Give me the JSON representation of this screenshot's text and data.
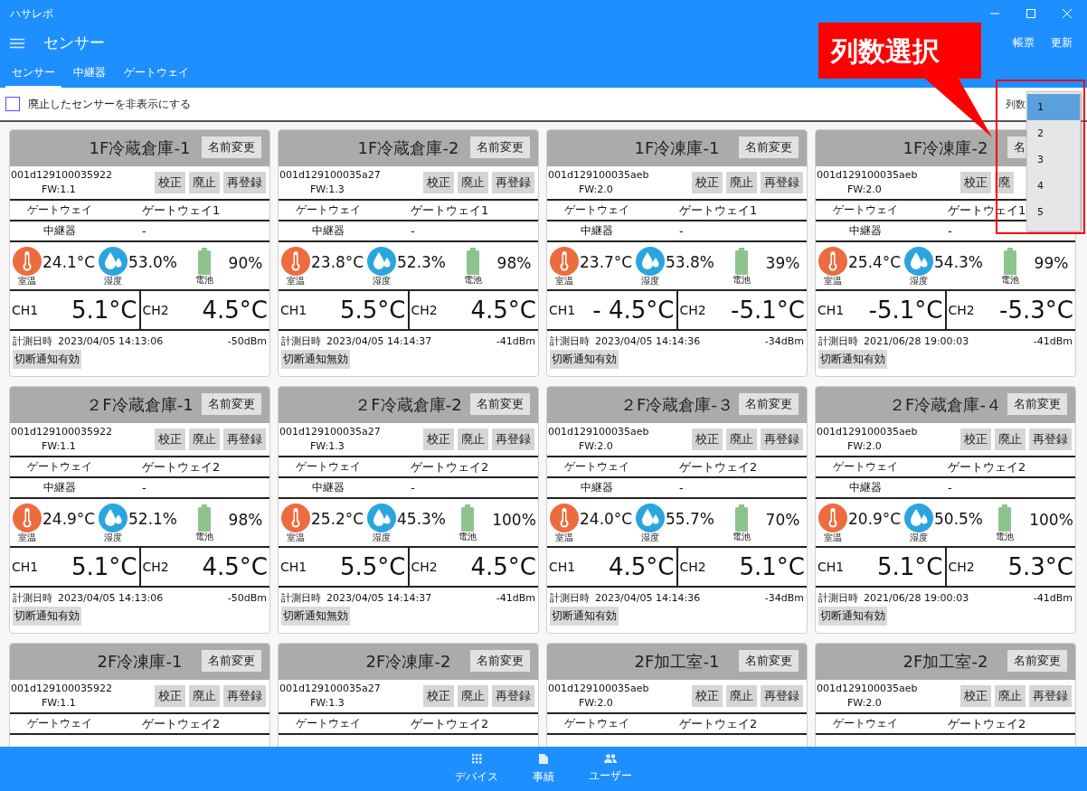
{
  "window": {
    "title": "ハサレポ"
  },
  "header": {
    "title": "センサー",
    "actions": [
      "帳票",
      "更新"
    ]
  },
  "tabs": [
    {
      "label": "センサー",
      "selected": true
    },
    {
      "label": "中継器",
      "selected": false
    },
    {
      "label": "ゲートウェイ",
      "selected": false
    }
  ],
  "filter": {
    "label": "廃止したセンサーを非表示にする",
    "checked": false
  },
  "columns": {
    "label": "列数",
    "options": [
      {
        "label": "1",
        "selected": true
      },
      {
        "label": "2",
        "selected": false
      },
      {
        "label": "3",
        "selected": false
      },
      {
        "label": "4",
        "selected": false
      },
      {
        "label": "5",
        "selected": false
      }
    ]
  },
  "callout": {
    "text": "列数選択"
  },
  "cards": [
    {
      "name": "1F冷蔵倉庫-1",
      "rename": "名前変更",
      "id": "001d129100035922",
      "fw": "FW:1.1",
      "actions": [
        "校正",
        "廃止",
        "再登録"
      ],
      "rows": [
        {
          "label": "ゲートウェイ",
          "value": "ゲートウェイ1"
        },
        {
          "label": "中継器",
          "value": "-"
        }
      ],
      "readings": [
        {
          "kind": "temperature",
          "caption": "室温",
          "value": "24.1°C"
        },
        {
          "kind": "humidity",
          "caption": "湿度",
          "value": "53.0%"
        },
        {
          "kind": "battery",
          "caption": "電池",
          "value": "90%"
        }
      ],
      "channels": [
        {
          "label": "CH1",
          "value": "5.1°C"
        },
        {
          "label": "CH2",
          "value": "4.5°C"
        }
      ],
      "measured_label": "計測日時",
      "measured": "2023/04/05 14:13:06",
      "signal": "-50dBm",
      "notify": "切断通知有効"
    },
    {
      "name": "1F冷蔵倉庫-2",
      "rename": "名前変更",
      "id": "001d129100035a27",
      "fw": "FW:1.3",
      "actions": [
        "校正",
        "廃止",
        "再登録"
      ],
      "rows": [
        {
          "label": "ゲートウェイ",
          "value": "ゲートウェイ1"
        },
        {
          "label": "中継器",
          "value": "-"
        }
      ],
      "readings": [
        {
          "kind": "temperature",
          "caption": "室温",
          "value": "23.8°C"
        },
        {
          "kind": "humidity",
          "caption": "湿度",
          "value": "52.3%"
        },
        {
          "kind": "battery",
          "caption": "電池",
          "value": "98%"
        }
      ],
      "channels": [
        {
          "label": "CH1",
          "value": "5.5°C"
        },
        {
          "label": "CH2",
          "value": "4.5°C"
        }
      ],
      "measured_label": "計測日時",
      "measured": "2023/04/05 14:14:37",
      "signal": "-41dBm",
      "notify": "切断通知無効"
    },
    {
      "name": "1F冷凍庫-1",
      "rename": "名前変更",
      "id": "001d129100035aeb",
      "fw": "FW:2.0",
      "actions": [
        "校正",
        "廃止",
        "再登録"
      ],
      "rows": [
        {
          "label": "ゲートウェイ",
          "value": "ゲートウェイ1"
        },
        {
          "label": "中継器",
          "value": "-"
        }
      ],
      "readings": [
        {
          "kind": "temperature",
          "caption": "室温",
          "value": "23.7°C"
        },
        {
          "kind": "humidity",
          "caption": "湿度",
          "value": "53.8%"
        },
        {
          "kind": "battery",
          "caption": "電池",
          "value": "39%"
        }
      ],
      "channels": [
        {
          "label": "CH1",
          "value": "- 4.5°C"
        },
        {
          "label": "CH2",
          "value": "-5.1°C"
        }
      ],
      "measured_label": "計測日時",
      "measured": "2023/04/05 14:14:36",
      "signal": "-34dBm",
      "notify": "切断通知有効"
    },
    {
      "name": "1F冷凍庫-2",
      "rename": "名",
      "id": "001d129100035aeb",
      "fw": "FW:2.0",
      "actions": [
        "校正",
        "廃"
      ],
      "rows": [
        {
          "label": "ゲートウェイ",
          "value": "ゲートウェイ1"
        },
        {
          "label": "中継器",
          "value": "-"
        }
      ],
      "readings": [
        {
          "kind": "temperature",
          "caption": "室温",
          "value": "25.4°C"
        },
        {
          "kind": "humidity",
          "caption": "湿度",
          "value": "54.3%"
        },
        {
          "kind": "battery",
          "caption": "電池",
          "value": "99%"
        }
      ],
      "channels": [
        {
          "label": "CH1",
          "value": "-5.1°C"
        },
        {
          "label": "CH2",
          "value": "-5.3°C"
        }
      ],
      "measured_label": "計測日時",
      "measured": "2021/06/28 19:00:03",
      "signal": "-41dBm",
      "notify": "切断通知有効"
    },
    {
      "name": "２F冷蔵倉庫-1",
      "rename": "名前変更",
      "id": "001d129100035922",
      "fw": "FW:1.1",
      "actions": [
        "校正",
        "廃止",
        "再登録"
      ],
      "rows": [
        {
          "label": "ゲートウェイ",
          "value": "ゲートウェイ2"
        },
        {
          "label": "中継器",
          "value": "-"
        }
      ],
      "readings": [
        {
          "kind": "temperature",
          "caption": "室温",
          "value": "24.9°C"
        },
        {
          "kind": "humidity",
          "caption": "湿度",
          "value": "52.1%"
        },
        {
          "kind": "battery",
          "caption": "電池",
          "value": "98%"
        }
      ],
      "channels": [
        {
          "label": "CH1",
          "value": "5.1°C"
        },
        {
          "label": "CH2",
          "value": "4.5°C"
        }
      ],
      "measured_label": "計測日時",
      "measured": "2023/04/05 14:13:06",
      "signal": "-50dBm",
      "notify": "切断通知有効"
    },
    {
      "name": "２F冷蔵倉庫-2",
      "rename": "名前変更",
      "id": "001d129100035a27",
      "fw": "FW:1.3",
      "actions": [
        "校正",
        "廃止",
        "再登録"
      ],
      "rows": [
        {
          "label": "ゲートウェイ",
          "value": "ゲートウェイ2"
        },
        {
          "label": "中継器",
          "value": "-"
        }
      ],
      "readings": [
        {
          "kind": "temperature",
          "caption": "室温",
          "value": "25.2°C"
        },
        {
          "kind": "humidity",
          "caption": "湿度",
          "value": "45.3%"
        },
        {
          "kind": "battery",
          "caption": "電池",
          "value": "100%"
        }
      ],
      "channels": [
        {
          "label": "CH1",
          "value": "5.5°C"
        },
        {
          "label": "CH2",
          "value": "4.5°C"
        }
      ],
      "measured_label": "計測日時",
      "measured": "2023/04/05 14:14:37",
      "signal": "-41dBm",
      "notify": "切断通知無効"
    },
    {
      "name": "２F冷蔵倉庫-３",
      "rename": "名前変更",
      "id": "001d129100035aeb",
      "fw": "FW:2.0",
      "actions": [
        "校正",
        "廃止",
        "再登録"
      ],
      "rows": [
        {
          "label": "ゲートウェイ",
          "value": "ゲートウェイ2"
        },
        {
          "label": "中継器",
          "value": "-"
        }
      ],
      "readings": [
        {
          "kind": "temperature",
          "caption": "室温",
          "value": "24.0°C"
        },
        {
          "kind": "humidity",
          "caption": "湿度",
          "value": "55.7%"
        },
        {
          "kind": "battery",
          "caption": "電池",
          "value": "70%"
        }
      ],
      "channels": [
        {
          "label": "CH1",
          "value": "4.5°C"
        },
        {
          "label": "CH2",
          "value": "5.1°C"
        }
      ],
      "measured_label": "計測日時",
      "measured": "2023/04/05 14:14:36",
      "signal": "-34dBm",
      "notify": "切断通知有効"
    },
    {
      "name": "２F冷蔵倉庫-４",
      "rename": "名前変更",
      "id": "001d129100035aeb",
      "fw": "FW:2.0",
      "actions": [
        "校正",
        "廃止",
        "再登録"
      ],
      "rows": [
        {
          "label": "ゲートウェイ",
          "value": "ゲートウェイ2"
        },
        {
          "label": "中継器",
          "value": "-"
        }
      ],
      "readings": [
        {
          "kind": "temperature",
          "caption": "室温",
          "value": "20.9°C"
        },
        {
          "kind": "humidity",
          "caption": "湿度",
          "value": "50.5%"
        },
        {
          "kind": "battery",
          "caption": "電池",
          "value": "100%"
        }
      ],
      "channels": [
        {
          "label": "CH1",
          "value": "5.1°C"
        },
        {
          "label": "CH2",
          "value": "5.3°C"
        }
      ],
      "measured_label": "計測日時",
      "measured": "2021/06/28 19:00:03",
      "signal": "-41dBm",
      "notify": "切断通知有効"
    },
    {
      "name": "2F冷凍庫-1",
      "rename": "名前変更",
      "id": "001d129100035922",
      "fw": "FW:1.1",
      "actions": [
        "校正",
        "廃止",
        "再登録"
      ],
      "rows": [
        {
          "label": "ゲートウェイ",
          "value": "ゲートウェイ2"
        }
      ]
    },
    {
      "name": "2F冷凍庫-2",
      "rename": "名前変更",
      "id": "001d129100035a27",
      "fw": "FW:1.3",
      "actions": [
        "校正",
        "廃止",
        "再登録"
      ],
      "rows": [
        {
          "label": "ゲートウェイ",
          "value": "ゲートウェイ2"
        }
      ]
    },
    {
      "name": "2F加工室-1",
      "rename": "名前変更",
      "id": "001d129100035aeb",
      "fw": "FW:2.0",
      "actions": [
        "校正",
        "廃止",
        "再登録"
      ],
      "rows": [
        {
          "label": "ゲートウェイ",
          "value": "ゲートウェイ2"
        }
      ]
    },
    {
      "name": "2F加工室-2",
      "rename": "名前変更",
      "id": "001d129100035aeb",
      "fw": "FW:2.0",
      "actions": [
        "校正",
        "廃止",
        "再登録"
      ],
      "rows": [
        {
          "label": "ゲートウェイ",
          "value": "ゲートウェイ2"
        }
      ]
    }
  ],
  "bottom_nav": [
    {
      "kind": "devices",
      "label": "デバイス"
    },
    {
      "kind": "records",
      "label": "事績"
    },
    {
      "kind": "users",
      "label": "ユーザー"
    }
  ]
}
